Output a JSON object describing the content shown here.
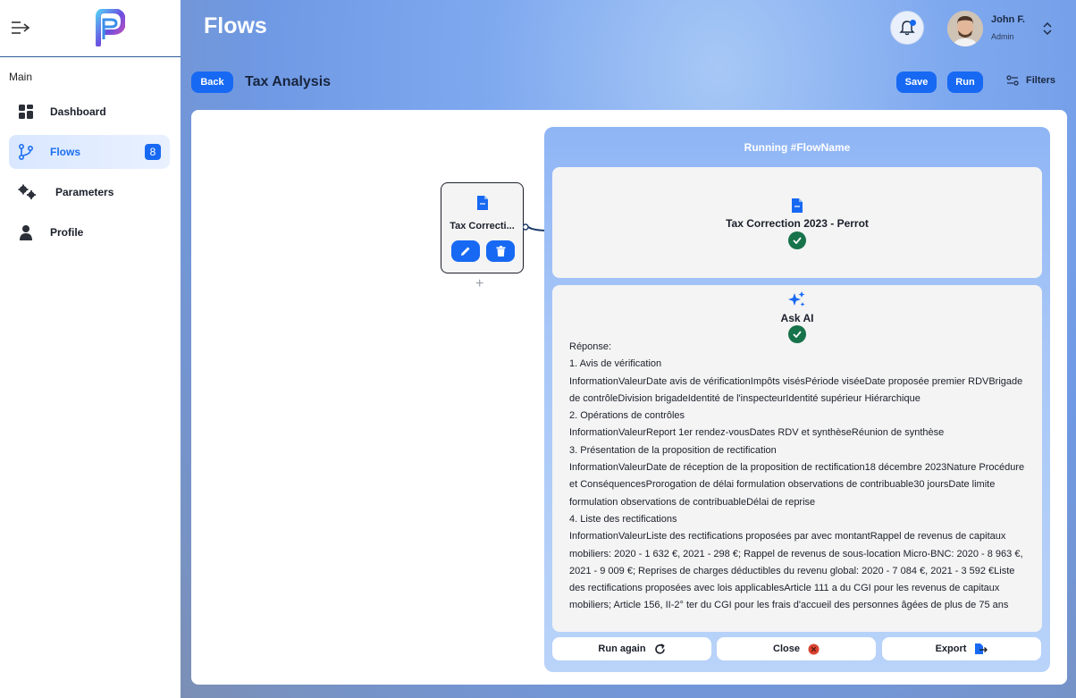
{
  "sidebar": {
    "section_label": "Main",
    "items": [
      {
        "label": "Dashboard"
      },
      {
        "label": "Flows",
        "badge": "8",
        "active": true
      },
      {
        "label": "Parameters"
      },
      {
        "label": "Profile"
      }
    ]
  },
  "header": {
    "title": "Flows",
    "user": {
      "name": "John F.",
      "role": "Admin"
    }
  },
  "toolbar": {
    "back_label": "Back",
    "title": "Tax Analysis",
    "save_label": "Save",
    "run_label": "Run",
    "filters_label": "Filters"
  },
  "node": {
    "title": "Tax Correcti..."
  },
  "run_panel": {
    "title": "Running #FlowName",
    "step1": {
      "title": "Tax Correction 2023 - Perrot",
      "status": "success"
    },
    "step2": {
      "title": "Ask AI",
      "status": "success"
    },
    "response_lines": [
      "Réponse:",
      "1. Avis de vérification",
      "InformationValeurDate avis de vérificationImpôts visésPériode viséeDate proposée premier RDVBrigade de contrôleDivision brigadeIdentité de l'inspecteurIdentité supérieur Hiérarchique",
      "2. Opérations de contrôles",
      "InformationValeurReport 1er rendez-vousDates RDV et synthèseRéunion de synthèse",
      "3. Présentation de la proposition de rectification",
      "InformationValeurDate de réception de la proposition de rectification18 décembre 2023Nature Procédure et ConséquencesProrogation de délai formulation observations de contribuable30 joursDate limite formulation observations de contribuableDélai de reprise",
      "4. Liste des rectifications",
      "InformationValeurListe des rectifications proposées par avec montantRappel de revenus de capitaux mobiliers: 2020 - 1 632 €, 2021 - 298 €; Rappel de revenus de sous-location Micro-BNC: 2020 - 8 963 €, 2021 - 9 009 €; Reprises de charges déductibles du revenu global: 2020 - 7 084 €, 2021 - 3 592 €Liste des rectifications proposées avec lois applicablesArticle 111 a du CGI pour les revenus de capitaux mobiliers; Article 156, II-2° ter du CGI pour les frais d'accueil des personnes âgées de plus de 75 ans"
    ],
    "run_again_label": "Run again",
    "close_label": "Close",
    "export_label": "Export"
  },
  "colors": {
    "accent": "#1769f3",
    "success": "#17734a",
    "close_red": "#d9432f"
  }
}
